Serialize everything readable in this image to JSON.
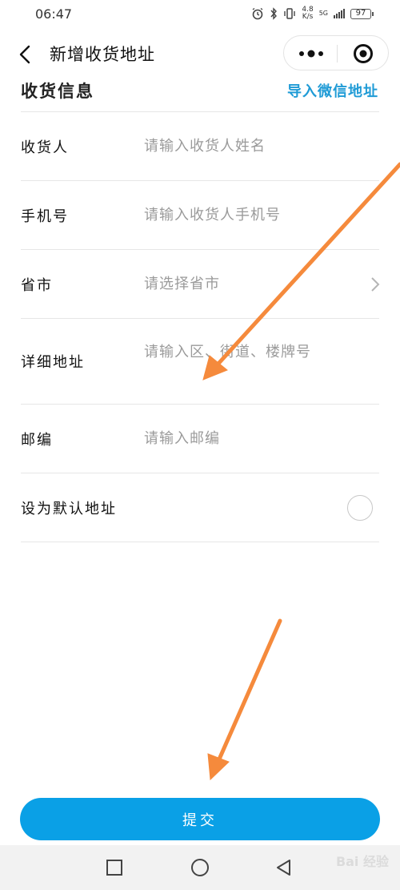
{
  "status_bar": {
    "time": "06:47",
    "net_speed_value": "4.8",
    "net_speed_unit": "K/s",
    "signal_label": "5G",
    "battery": "97"
  },
  "nav": {
    "title": "新增收货地址"
  },
  "section": {
    "title": "收货信息",
    "import_link": "导入微信地址"
  },
  "form": {
    "rows": [
      {
        "label": "收货人",
        "placeholder": "请输入收货人姓名",
        "value": ""
      },
      {
        "label": "手机号",
        "placeholder": "请输入收货人手机号",
        "value": ""
      },
      {
        "label": "省市",
        "placeholder": "请选择省市",
        "value": ""
      },
      {
        "label": "详细地址",
        "placeholder": "请输入区、街道、楼牌号",
        "value": ""
      },
      {
        "label": "邮编",
        "placeholder": "请输入邮编",
        "value": ""
      },
      {
        "label": "设为默认地址"
      }
    ]
  },
  "submit": {
    "label": "提交"
  },
  "watermark": {
    "text": "Bai 经验"
  },
  "colors": {
    "accent": "#0aa0e6",
    "link": "#1f9bd6",
    "annotation_arrow": "#f58a3c"
  }
}
